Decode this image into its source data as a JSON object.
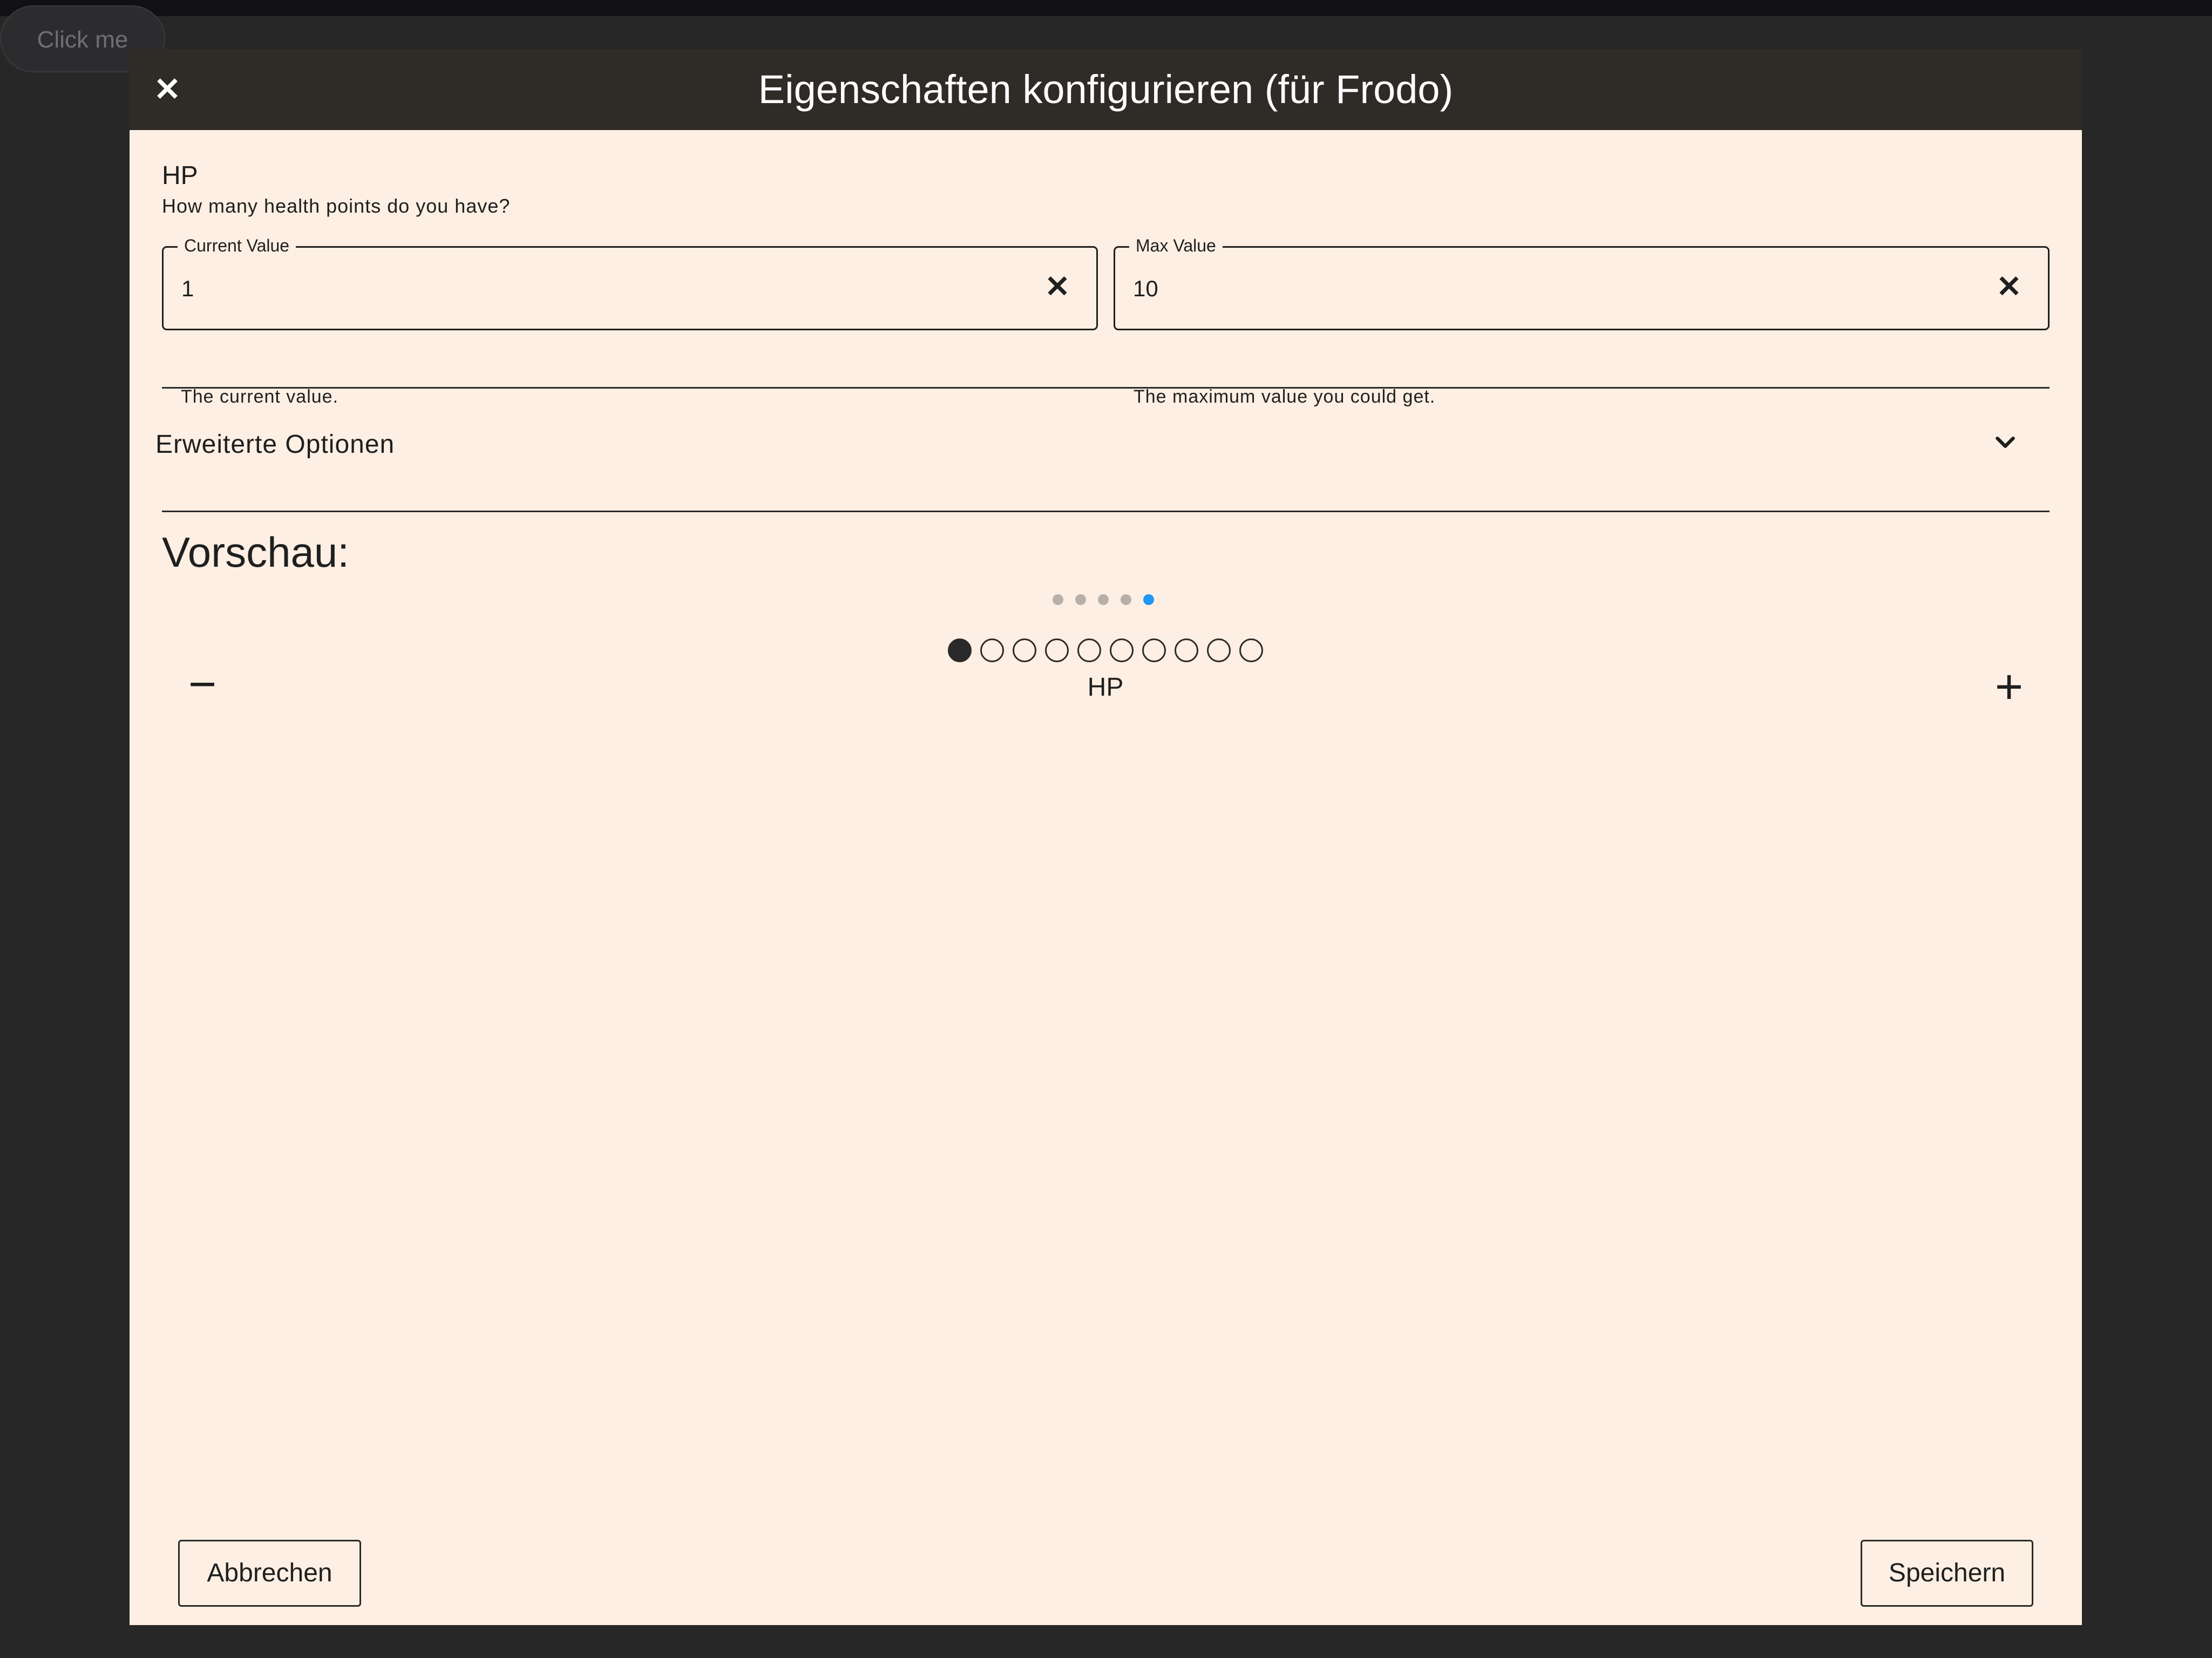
{
  "background": {
    "button_label": "Click me"
  },
  "dialog": {
    "title": "Eigenschaften konfigurieren (für Frodo)",
    "close_icon": "close-icon"
  },
  "attribute": {
    "name": "HP",
    "description": "How many health points do you have?",
    "current_field": {
      "label": "Current Value",
      "value": "1",
      "helper": "The current value."
    },
    "max_field": {
      "label": "Max Value",
      "value": "10",
      "helper": "The maximum value you could get."
    }
  },
  "advanced": {
    "label": "Erweiterte Optionen",
    "icon": "chevron-down-icon"
  },
  "preview": {
    "title": "Vorschau:",
    "pager": {
      "count": 5,
      "active_index": 4,
      "active_color": "#2196f3",
      "inactive_color": "#b7b0aa"
    },
    "tracker": {
      "current": 1,
      "max": 10,
      "label": "HP"
    },
    "decrement_icon": "minus-icon",
    "increment_icon": "plus-icon"
  },
  "footer": {
    "cancel_label": "Abbrechen",
    "save_label": "Speichern"
  },
  "colors": {
    "dialog_background": "#fdefe3",
    "header_background": "#2f2b26",
    "page_background": "#272727"
  }
}
